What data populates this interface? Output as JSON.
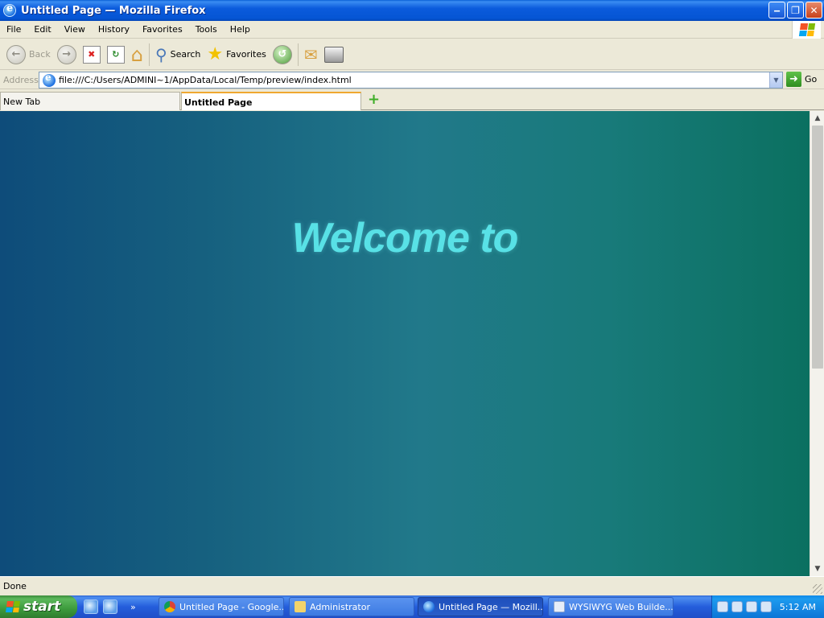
{
  "window": {
    "title": "Untitled Page — Mozilla Firefox",
    "controls": {
      "minimize": "‒",
      "maximize": "❐",
      "close": "✕"
    }
  },
  "menu": [
    "File",
    "Edit",
    "View",
    "History",
    "Favorites",
    "Tools",
    "Help"
  ],
  "toolbar": {
    "back_label": "Back",
    "search_label": "Search",
    "favorites_label": "Favorites"
  },
  "address": {
    "label": "Address",
    "url": "file:///C:/Users/ADMINI~1/AppData/Local/Temp/preview/index.html",
    "go_label": "Go"
  },
  "tabs": [
    {
      "label": "New Tab",
      "active": false
    },
    {
      "label": "Untitled Page",
      "active": true
    }
  ],
  "page": {
    "heading": "Welcome to",
    "heading_color": "#58e1e6"
  },
  "status": {
    "text": "Done"
  },
  "taskbar": {
    "start_label": "start",
    "quicklaunch_more": "»",
    "tasks": [
      {
        "label": "Untitled Page - Google...",
        "icon": "chrome-icon"
      },
      {
        "label": "Administrator",
        "icon": "folder-icon"
      },
      {
        "label": "Untitled Page — Mozill...",
        "icon": "firefox-icon",
        "active": true
      },
      {
        "label": "WYSIWYG Web Builde...",
        "icon": "wysiwyg-icon"
      }
    ],
    "clock": "5:12 AM"
  },
  "scroll": {
    "position": 0.0
  }
}
